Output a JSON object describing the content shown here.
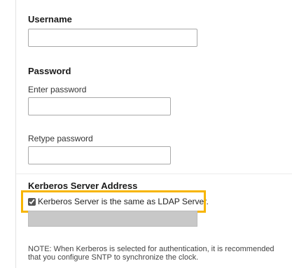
{
  "username": {
    "title": "Username",
    "value": ""
  },
  "password": {
    "title": "Password",
    "enter_label": "Enter password",
    "enter_value": "",
    "retype_label": "Retype password",
    "retype_value": ""
  },
  "kerberos": {
    "title": "Kerberos Server Address",
    "same_as_ldap_label": "Kerberos Server is the same as LDAP Server.",
    "same_as_ldap_checked": true,
    "address_value": ""
  },
  "note": "NOTE: When Kerberos is selected for authentication, it is recommended that you configure SNTP to synchronize the clock.",
  "colors": {
    "highlight": "#f7b500",
    "disabled_field": "#c8c8c8"
  }
}
